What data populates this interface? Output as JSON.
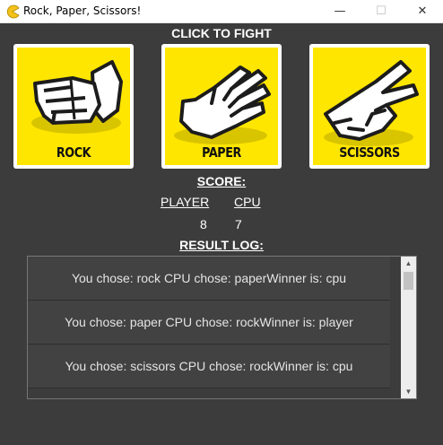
{
  "window": {
    "title": "Rock, Paper, Scissors!",
    "icon": "pacman-icon",
    "minimize_glyph": "—",
    "maximize_glyph": "☐",
    "close_glyph": "✕"
  },
  "header": {
    "title": "CLICK TO FIGHT"
  },
  "choices": [
    {
      "label": "ROCK",
      "icon": "rock-hand-icon"
    },
    {
      "label": "PAPER",
      "icon": "paper-hand-icon"
    },
    {
      "label": "SCISSORS",
      "icon": "scissors-hand-icon"
    }
  ],
  "score": {
    "title": "SCORE:",
    "player_label": "PLAYER",
    "cpu_label": "CPU",
    "player_value": "8",
    "cpu_value": "7"
  },
  "log": {
    "title": "RESULT LOG:",
    "entries": [
      "You chose: rock CPU chose: paperWinner is: cpu",
      "You chose: paper CPU chose: rockWinner is: player",
      "You chose: scissors CPU chose: rockWinner is: cpu"
    ]
  },
  "colors": {
    "background": "#3c3c3c",
    "button_yellow": "#ffe600"
  }
}
